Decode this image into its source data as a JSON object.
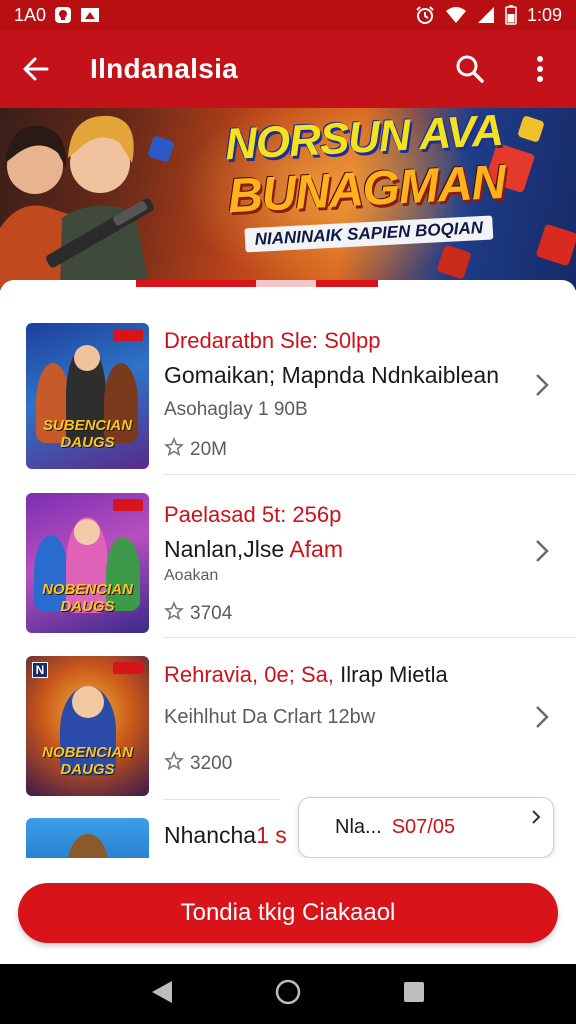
{
  "status_bar": {
    "left_text": "1A0",
    "time": "1:09",
    "icons": [
      "notification-icon",
      "flag-icon",
      "alarm-icon",
      "wifi-icon",
      "signal-icon",
      "battery-icon"
    ]
  },
  "app_bar": {
    "title": "Ilndanalsia",
    "icons": [
      "back-arrow-icon",
      "search-icon",
      "more-vert-icon"
    ]
  },
  "banner": {
    "line1": "NORSUN AVA",
    "line2": "BUNAGMAN",
    "line3": "NIANINAIK SAPIEN BOQIAN"
  },
  "list": [
    {
      "title": "Dredaratbn Sle: S0lpp",
      "subtitle": "Gomaikan; Mapnda Ndnkaiblean",
      "meta": "Asohaglay 1 90B",
      "rating": "20M",
      "thumb_caption": "SUBENCIAN DAUGS"
    },
    {
      "title": "Paelasad 5t: 256p",
      "subtitle_black": "Nanlan,Jlse",
      "subtitle_red": "Afam",
      "meta": "Aoakan",
      "rating": "3704",
      "thumb_caption": "NOBENCIAN DAUGS"
    },
    {
      "title_red": "Rehravia, 0e;",
      "title_red2": "Sa,",
      "title_black": "Ilrap Mietla",
      "subtitle": "Keihlhut Da Crlart 12bw",
      "rating": "3200",
      "thumb_caption": "NOBENCIAN DAUGS",
      "thumb_badge_left": "N"
    },
    {
      "title_black": "Nhancha",
      "title_red": "1 s"
    }
  ],
  "mini_card": {
    "label": "Nla...",
    "value": "S07/05"
  },
  "cta": {
    "label": "Tondia tkig Ciakaaol"
  },
  "nav_bar": {
    "icons": [
      "back-triangle-icon",
      "home-circle-icon",
      "recents-square-icon"
    ]
  },
  "colors": {
    "primary_red": "#c4121a",
    "accent_red": "#d8131a",
    "status_bar": "#b80f12"
  }
}
